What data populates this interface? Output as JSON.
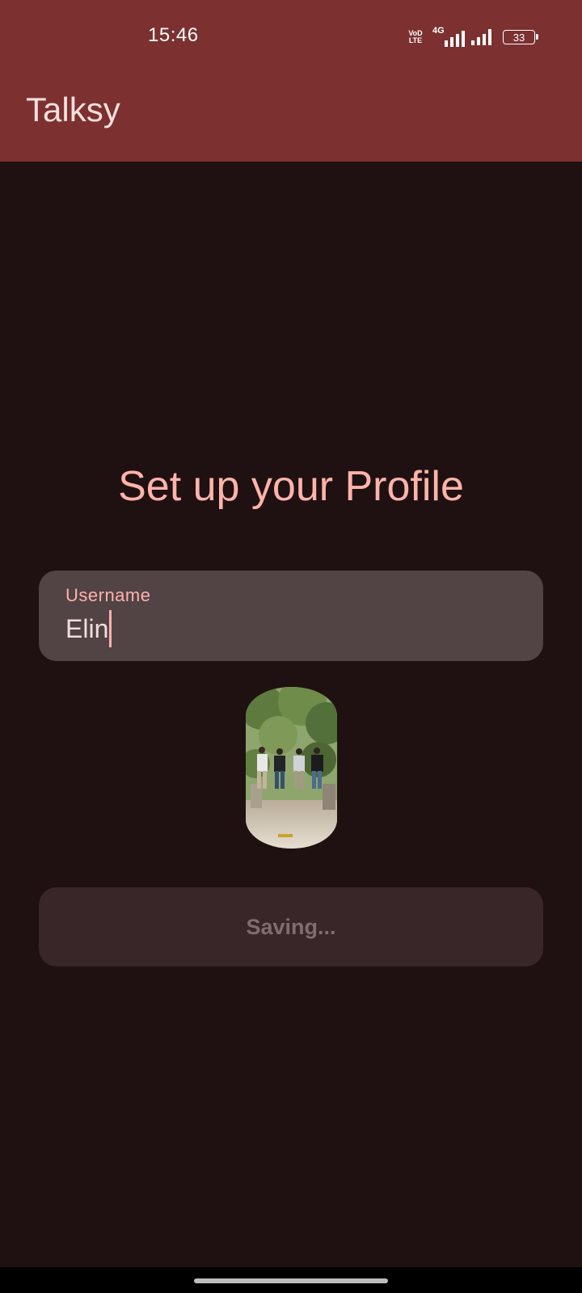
{
  "status_bar": {
    "time": "15:46",
    "volte_top": "VoD",
    "volte_bottom": "LTE",
    "network_type": "4G",
    "battery_level": "33",
    "signal_1_bars": 4,
    "signal_2_bars": 4
  },
  "app_bar": {
    "title": "Talksy"
  },
  "main": {
    "heading": "Set up your Profile",
    "username_field": {
      "label": "Username",
      "value": "Elin"
    },
    "avatar": {
      "icon": "profile-photo"
    },
    "save_button": {
      "label": "Saving...",
      "enabled": false
    }
  },
  "colors": {
    "app_bar": "#7c3030",
    "background": "#1f1111",
    "accent": "#ffb3ab",
    "field_background": "#524345",
    "button_background": "#382628",
    "button_text_disabled": "#7f6e6f"
  }
}
